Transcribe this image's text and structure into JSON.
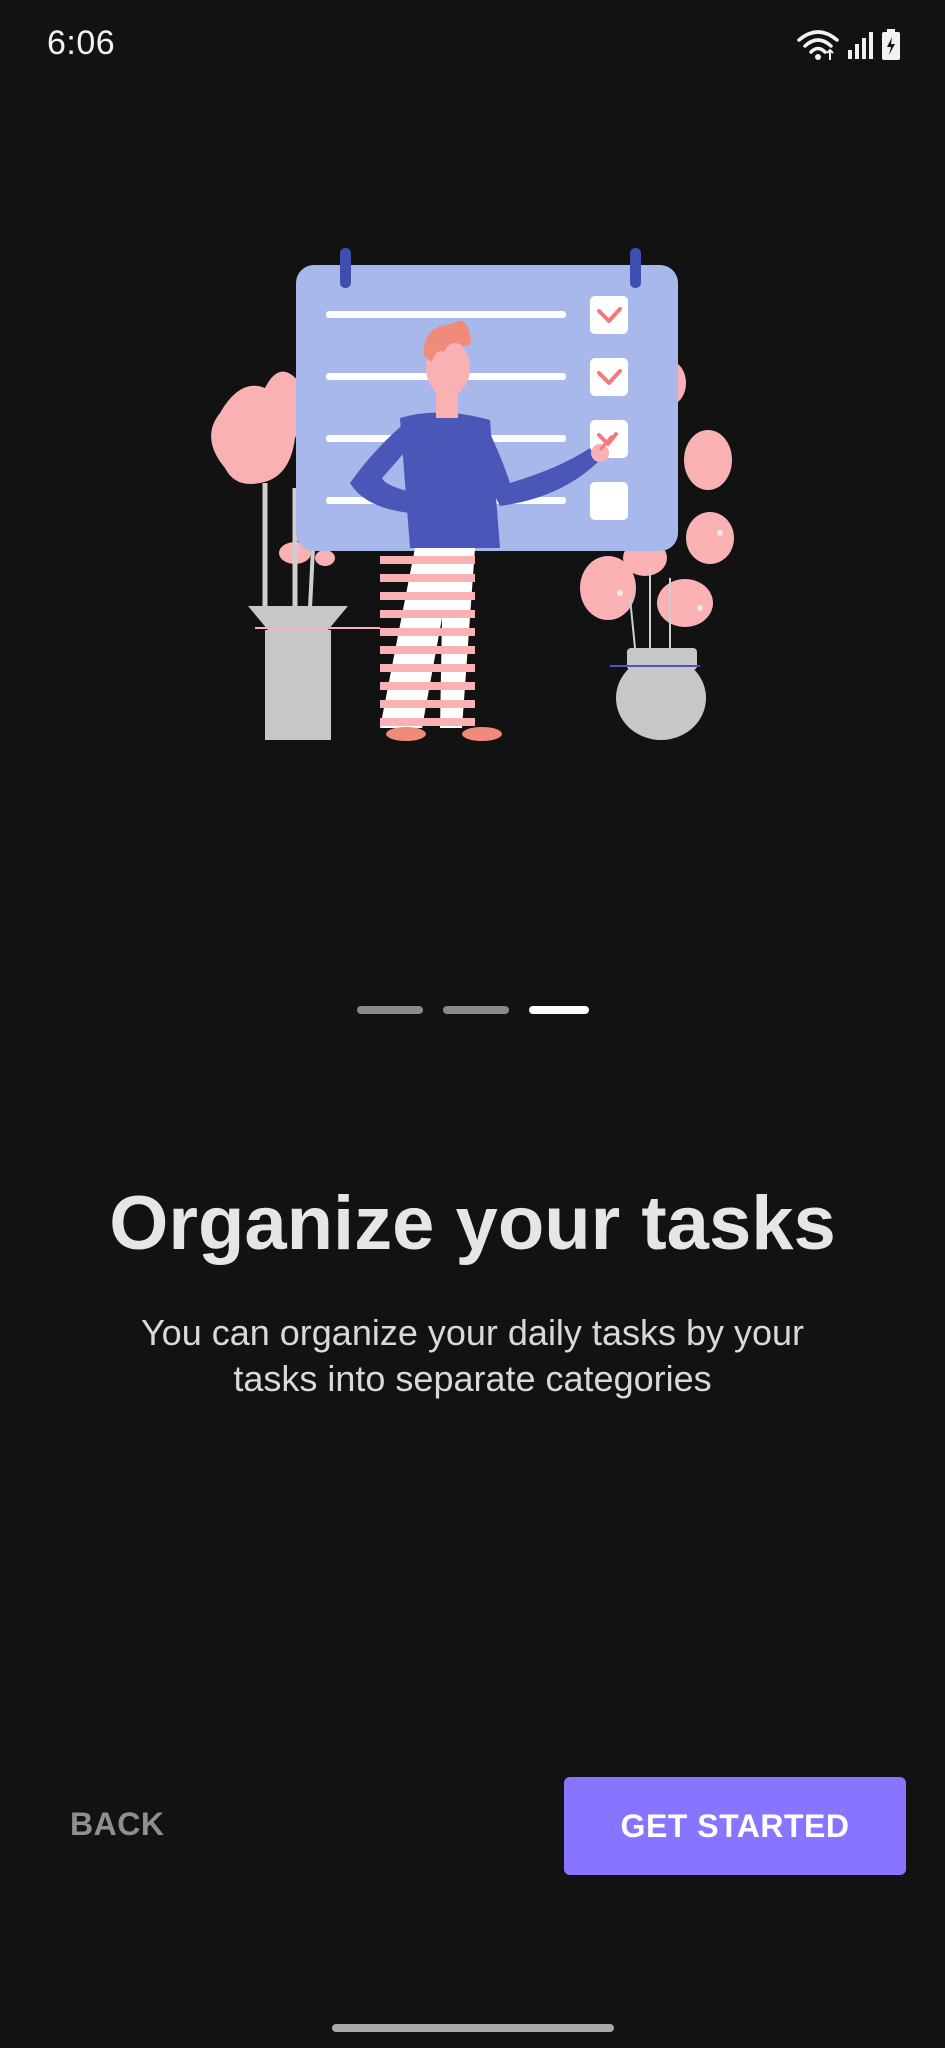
{
  "status_bar": {
    "time": "6:06",
    "icons": [
      "wifi-icon",
      "signal-icon",
      "battery-charging-icon"
    ]
  },
  "illustration": {
    "icon": "task-checklist-illustration"
  },
  "pager": {
    "count": 3,
    "active_index": 2
  },
  "onboarding": {
    "title": "Organize your tasks",
    "subtitle": "You can organize your daily tasks by your tasks into separate categories"
  },
  "actions": {
    "back_label": "BACK",
    "primary_label": "GET STARTED"
  },
  "colors": {
    "background": "#121212",
    "accent": "#8875ff",
    "board": "#a8b8ea",
    "pink": "#f9b1b3",
    "shirt": "#4a57b8"
  }
}
